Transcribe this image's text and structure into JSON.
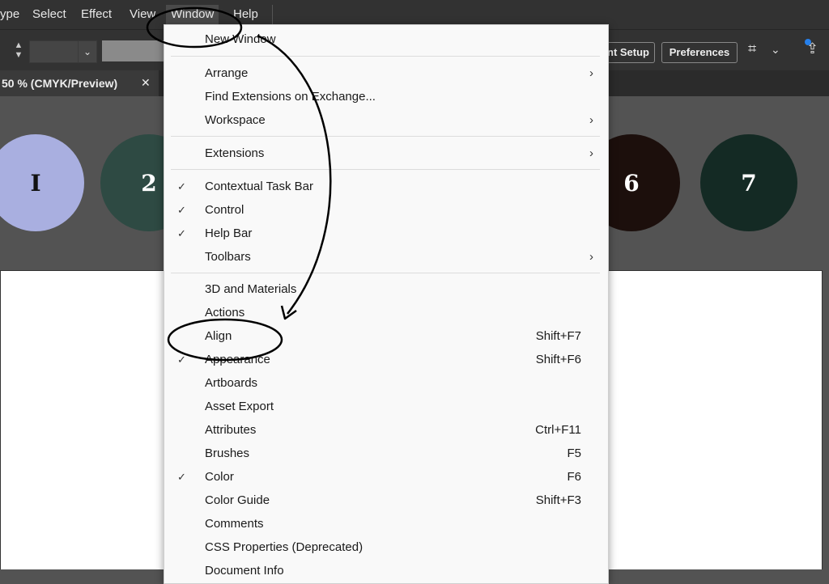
{
  "menubar": {
    "items": [
      "ype",
      "Select",
      "Effect",
      "View",
      "Window",
      "Help"
    ]
  },
  "control": {
    "stepper_up": "▲",
    "stepper_down": "▼",
    "dropdown_glyph": "⌄",
    "document_setup": "nt Setup",
    "preferences": "Preferences",
    "arrange_icon": "⌗",
    "chevron": "⌄",
    "share_icon": "⇪"
  },
  "tab": {
    "title": "50 % (CMYK/Preview)",
    "close": "✕"
  },
  "circles": [
    {
      "label": "I",
      "color": "#a9afe0",
      "text_color": "#111111"
    },
    {
      "label": "2",
      "color": "#2e4a43",
      "text_color": "#ffffff"
    },
    {
      "label": "6",
      "color": "#1c0f0c",
      "text_color": "#ffffff"
    },
    {
      "label": "7",
      "color": "#142a24",
      "text_color": "#ffffff"
    }
  ],
  "menu": {
    "items": [
      {
        "label": "New Window",
        "check": "",
        "shortcut": "",
        "arrow": ""
      },
      {
        "label": "Arrange",
        "check": "",
        "shortcut": "",
        "arrow": "›"
      },
      {
        "label": "Find Extensions on Exchange...",
        "check": "",
        "shortcut": "",
        "arrow": ""
      },
      {
        "label": "Workspace",
        "check": "",
        "shortcut": "",
        "arrow": "›"
      },
      {
        "label": "Extensions",
        "check": "",
        "shortcut": "",
        "arrow": "›"
      },
      {
        "label": "Contextual Task Bar",
        "check": "✓",
        "shortcut": "",
        "arrow": ""
      },
      {
        "label": "Control",
        "check": "✓",
        "shortcut": "",
        "arrow": ""
      },
      {
        "label": "Help Bar",
        "check": "✓",
        "shortcut": "",
        "arrow": ""
      },
      {
        "label": "Toolbars",
        "check": "",
        "shortcut": "",
        "arrow": "›"
      },
      {
        "label": "3D and Materials",
        "check": "",
        "shortcut": "",
        "arrow": ""
      },
      {
        "label": "Actions",
        "check": "",
        "shortcut": "",
        "arrow": ""
      },
      {
        "label": "Align",
        "check": "",
        "shortcut": "Shift+F7",
        "arrow": ""
      },
      {
        "label": "Appearance",
        "check": "✓",
        "shortcut": "Shift+F6",
        "arrow": ""
      },
      {
        "label": "Artboards",
        "check": "",
        "shortcut": "",
        "arrow": ""
      },
      {
        "label": "Asset Export",
        "check": "",
        "shortcut": "",
        "arrow": ""
      },
      {
        "label": "Attributes",
        "check": "",
        "shortcut": "Ctrl+F11",
        "arrow": ""
      },
      {
        "label": "Brushes",
        "check": "",
        "shortcut": "F5",
        "arrow": ""
      },
      {
        "label": "Color",
        "check": "✓",
        "shortcut": "F6",
        "arrow": ""
      },
      {
        "label": "Color Guide",
        "check": "",
        "shortcut": "Shift+F3",
        "arrow": ""
      },
      {
        "label": "Comments",
        "check": "",
        "shortcut": "",
        "arrow": ""
      },
      {
        "label": "CSS Properties (Deprecated)",
        "check": "",
        "shortcut": "",
        "arrow": ""
      },
      {
        "label": "Document Info",
        "check": "",
        "shortcut": "",
        "arrow": ""
      }
    ]
  }
}
